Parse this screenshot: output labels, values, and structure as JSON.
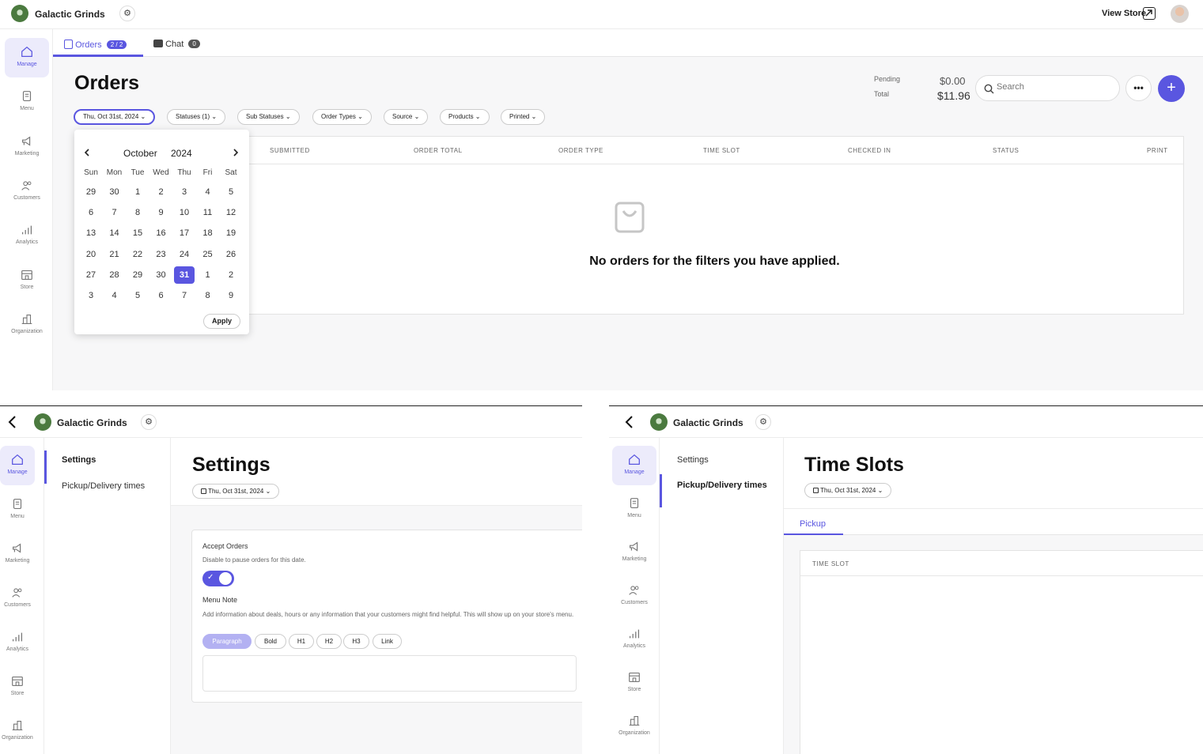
{
  "store_name": "Galactic Grinds",
  "icons": {
    "settings": "gear-icon",
    "back": "chevron-left-icon",
    "external": "external-link-icon"
  },
  "colors": {
    "accent": "#5a56e0",
    "logo": "#4b7a3f"
  },
  "nav_items": [
    "Manage",
    "Menu",
    "Marketing",
    "Customers",
    "Analytics",
    "Store",
    "Organization"
  ],
  "orders_screen": {
    "view_store": "View Store",
    "tabs": {
      "orders_label": "Orders",
      "orders_badge": "2 / 2",
      "chat_label": "Chat",
      "chat_badge": "0"
    },
    "title": "Orders",
    "summary": {
      "pending_label": "Pending",
      "pending_value": "$0.00",
      "total_label": "Total",
      "total_value": "$11.96"
    },
    "search_placeholder": "Search",
    "more_label": "•••",
    "add_label": "+",
    "filters": [
      "Thu, Oct 31st, 2024",
      "Statuses (1)",
      "Sub Statuses",
      "Order Types",
      "Source",
      "Products",
      "Printed"
    ],
    "columns": [
      "SUBMITTED",
      "ORDER TOTAL",
      "ORDER TYPE",
      "TIME SLOT",
      "CHECKED IN",
      "STATUS",
      "PRINT"
    ],
    "empty_message": "No orders for the filters you have applied.",
    "calendar": {
      "month": "October",
      "year": "2024",
      "weekdays": [
        "Sun",
        "Mon",
        "Tue",
        "Wed",
        "Thu",
        "Fri",
        "Sat"
      ],
      "weeks": [
        [
          "29",
          "30",
          "1",
          "2",
          "3",
          "4",
          "5"
        ],
        [
          "6",
          "7",
          "8",
          "9",
          "10",
          "11",
          "12"
        ],
        [
          "13",
          "14",
          "15",
          "16",
          "17",
          "18",
          "19"
        ],
        [
          "20",
          "21",
          "22",
          "23",
          "24",
          "25",
          "26"
        ],
        [
          "27",
          "28",
          "29",
          "30",
          "31",
          "1",
          "2"
        ],
        [
          "3",
          "4",
          "5",
          "6",
          "7",
          "8",
          "9"
        ]
      ],
      "selected": "31",
      "apply_label": "Apply"
    }
  },
  "settings_screen": {
    "subnav": [
      "Settings",
      "Pickup/Delivery times"
    ],
    "title": "Settings",
    "date_label": "Thu, Oct 31st, 2024",
    "accept_title": "Accept Orders",
    "accept_desc": "Disable to pause orders for this date.",
    "accept_on": true,
    "note_title": "Menu Note",
    "note_desc": "Add information about deals, hours or any information that your customers might find helpful. This will show up on your store's menu.",
    "format_buttons": [
      "Paragraph",
      "Bold",
      "H1",
      "H2",
      "H3",
      "Link"
    ]
  },
  "timeslots_screen": {
    "subnav": [
      "Settings",
      "Pickup/Delivery times"
    ],
    "title": "Time Slots",
    "date_label": "Thu, Oct 31st, 2024",
    "tab_label": "Pickup",
    "column": "TIME SLOT"
  }
}
